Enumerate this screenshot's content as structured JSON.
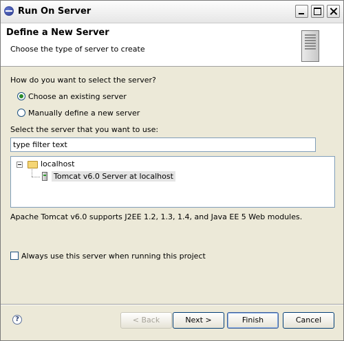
{
  "window": {
    "title": "Run On Server"
  },
  "banner": {
    "title": "Define a New Server",
    "description": "Choose the type of server to create"
  },
  "selection": {
    "question": "How do you want to select the server?",
    "options": [
      {
        "label": "Choose an existing server",
        "selected": true
      },
      {
        "label": "Manually define a new server",
        "selected": false
      }
    ],
    "list_prompt": "Select the server that you want to use:"
  },
  "filter": {
    "value": "type filter text"
  },
  "tree": {
    "host": "localhost",
    "server": "Tomcat v6.0 Server at localhost"
  },
  "server_description": "Apache Tomcat v6.0 supports J2EE 1.2, 1.3, 1.4, and Java EE 5 Web modules.",
  "always_use": {
    "label": "Always use this server when running this project",
    "checked": false
  },
  "buttons": {
    "back": "< Back",
    "next": "Next >",
    "finish": "Finish",
    "cancel": "Cancel"
  },
  "help": {
    "glyph": "?"
  }
}
